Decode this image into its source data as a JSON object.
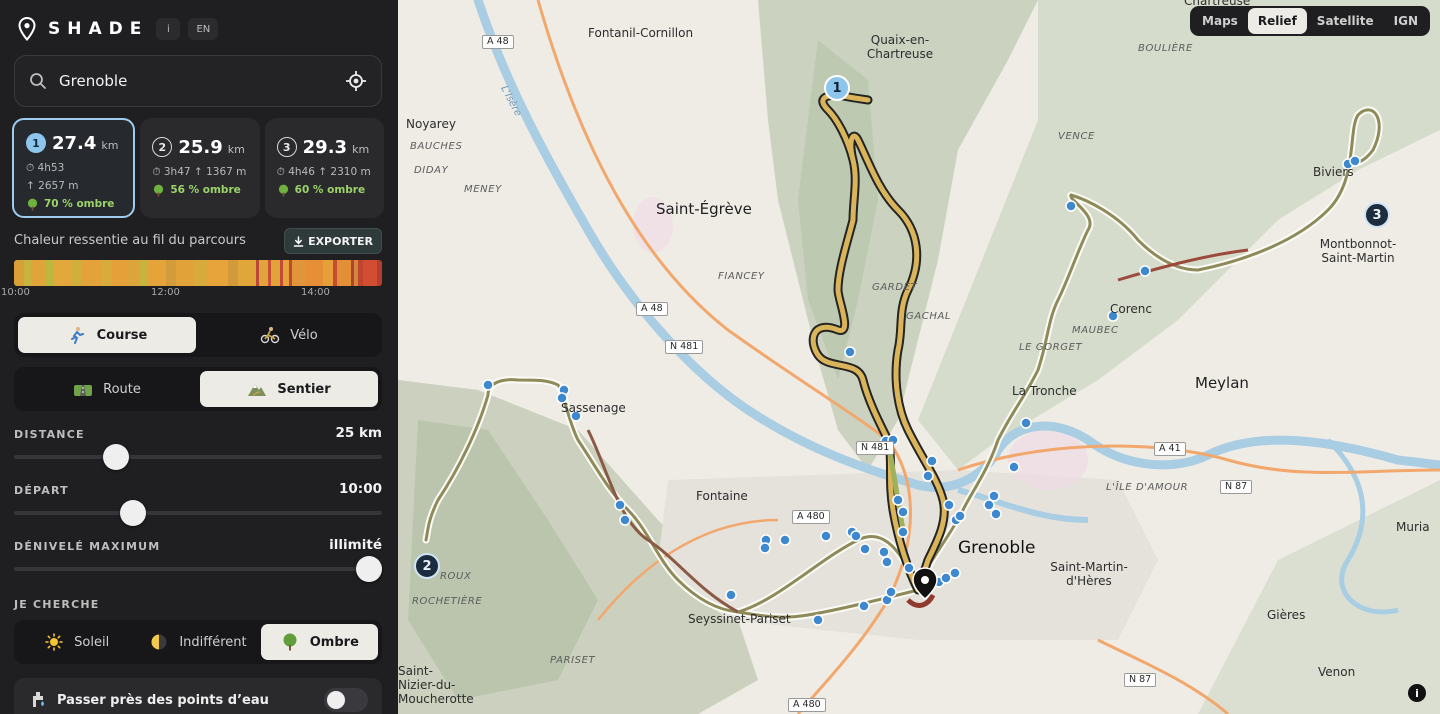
{
  "app": {
    "name": "SHADE",
    "info_label": "i",
    "lang_label": "EN"
  },
  "search": {
    "value": "Grenoble",
    "placeholder": "Grenoble"
  },
  "routes": [
    {
      "index": "1",
      "distance": "27.4",
      "unit": "km",
      "duration": "4h53",
      "elevation": "2657 m",
      "shade": "70 % ombre",
      "selected": true
    },
    {
      "index": "2",
      "distance": "25.9",
      "unit": "km",
      "duration": "3h47",
      "elevation": "1367 m",
      "shade": "56 % ombre",
      "selected": false
    },
    {
      "index": "3",
      "distance": "29.3",
      "unit": "km",
      "duration": "4h46",
      "elevation": "2310 m",
      "shade": "60 % ombre",
      "selected": false
    }
  ],
  "heat": {
    "title": "Chaleur ressentie au fil du parcours",
    "export_label": "EXPORTER",
    "ticks": [
      "10:00",
      "12:00",
      "14:00"
    ],
    "segments": [
      {
        "color": "#d9a03a",
        "w": 6
      },
      {
        "color": "#c8b33e",
        "w": 4
      },
      {
        "color": "#e0a43a",
        "w": 8
      },
      {
        "color": "#b9b83f",
        "w": 5
      },
      {
        "color": "#e2a83c",
        "w": 10
      },
      {
        "color": "#cfb03d",
        "w": 6
      },
      {
        "color": "#e4a23a",
        "w": 12
      },
      {
        "color": "#d7ac3b",
        "w": 6
      },
      {
        "color": "#e6a03a",
        "w": 9
      },
      {
        "color": "#dca53b",
        "w": 7
      },
      {
        "color": "#c7b43e",
        "w": 4
      },
      {
        "color": "#e5a43a",
        "w": 11
      },
      {
        "color": "#d39c3a",
        "w": 6
      },
      {
        "color": "#e2a23a",
        "w": 10
      },
      {
        "color": "#d8a93b",
        "w": 8
      },
      {
        "color": "#e6a43a",
        "w": 12
      },
      {
        "color": "#d29b3a",
        "w": 6
      },
      {
        "color": "#e0a63a",
        "w": 10
      },
      {
        "color": "#b8483a",
        "w": 2
      },
      {
        "color": "#e4a23a",
        "w": 5
      },
      {
        "color": "#c64f38",
        "w": 2
      },
      {
        "color": "#e2a43a",
        "w": 5
      },
      {
        "color": "#c24a36",
        "w": 2
      },
      {
        "color": "#e6a23a",
        "w": 3
      },
      {
        "color": "#bf4733",
        "w": 2
      },
      {
        "color": "#e0953a",
        "w": 8
      },
      {
        "color": "#e78f36",
        "w": 10
      },
      {
        "color": "#e5a03a",
        "w": 6
      },
      {
        "color": "#c54b35",
        "w": 2
      },
      {
        "color": "#e28f37",
        "w": 8
      },
      {
        "color": "#b24230",
        "w": 2
      },
      {
        "color": "#d2873a",
        "w": 2
      },
      {
        "color": "#c0452f",
        "w": 3
      },
      {
        "color": "#d24d32",
        "w": 8
      },
      {
        "color": "#b63e2e",
        "w": 3
      }
    ]
  },
  "activity": {
    "options": [
      "Course",
      "Vélo"
    ],
    "selected": "Course"
  },
  "terrain": {
    "options": [
      "Route",
      "Sentier"
    ],
    "selected": "Sentier"
  },
  "distance": {
    "label": "DISTANCE",
    "value": "25 km",
    "level": 0.26
  },
  "depart": {
    "label": "DÉPART",
    "value": "10:00",
    "level": 0.31
  },
  "denivele": {
    "label": "DÉNIVELÉ MAXIMUM",
    "value": "illimité",
    "level": 1.0
  },
  "cherche": {
    "label": "JE CHERCHE",
    "options": [
      "Soleil",
      "Indifférent",
      "Ombre"
    ],
    "selected": "Ombre"
  },
  "water": {
    "label": "Passer près des points d’eau",
    "on": false
  },
  "map": {
    "styles": [
      "Maps",
      "Relief",
      "Satellite",
      "IGN"
    ],
    "selected_style": "Relief",
    "markers": [
      "1",
      "2",
      "3"
    ],
    "places": [
      "Fontanil-Cornillon",
      "Quaix-en-Chartreuse",
      "Noyarey",
      "Saint-Égrève",
      "Sassenage",
      "Fontaine",
      "Seyssinet-Pariset",
      "Grenoble",
      "Saint-Martin-d'Hères",
      "Meylan",
      "La Tronche",
      "Corenc",
      "Biviers",
      "Montbonnot-Saint-Martin",
      "Gières",
      "Venon",
      "Saint-Nizier-du-Moucherotte",
      "Muria",
      "Chartreuse"
    ],
    "localities": [
      "BOULIÈRE",
      "VENCE",
      "BAUCHES",
      "DIDAY",
      "MENEY",
      "FIANCEY",
      "MAUBEC",
      "LE GORGET",
      "L'ÎLE D'AMOUR",
      "ROCHETIÈRE",
      "PARISET",
      "ROUX",
      "GACHAL",
      "GARDET"
    ],
    "river": "L'Isère",
    "road_labels": [
      "A 48",
      "A 48",
      "N 481",
      "N 481",
      "A 480",
      "A 480",
      "A 41",
      "N 87",
      "N 87"
    ]
  }
}
